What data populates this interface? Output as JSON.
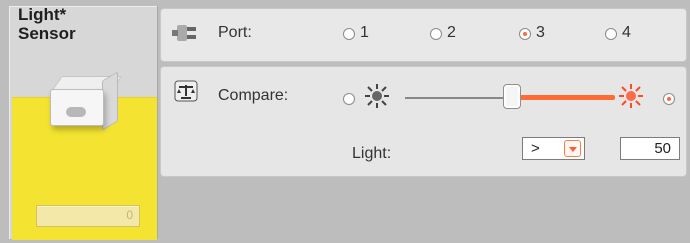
{
  "block": {
    "title_line1": "Light*",
    "title_line2": "Sensor",
    "small_field_value": "0"
  },
  "port": {
    "label": "Port:",
    "options": [
      "1",
      "2",
      "3",
      "4"
    ],
    "selected": "3"
  },
  "compare": {
    "label": "Compare:",
    "slider_value_fraction": 0.5,
    "active_side": "right"
  },
  "light": {
    "label": "Light:",
    "operator": ">",
    "value": "50"
  },
  "colors": {
    "accent": "#ff6a35",
    "yellow": "#f4e431"
  }
}
